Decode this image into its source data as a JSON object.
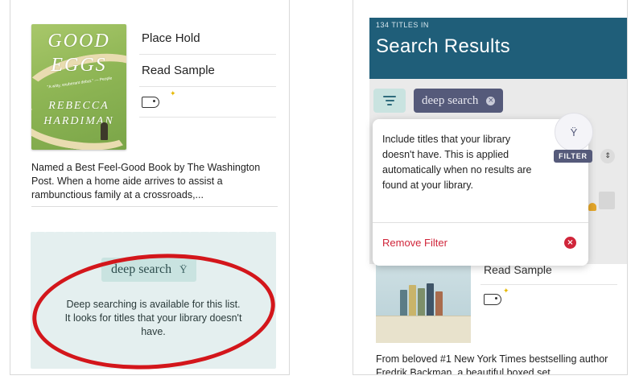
{
  "left": {
    "cover": {
      "title": "GOOD\nEGGS",
      "blurb": "\"A witty, exuberant debut.\" — People",
      "author": "REBECCA\nHARDIMAN"
    },
    "actions": [
      "Place Hold",
      "Read Sample"
    ],
    "tag_icon": "tag-icon",
    "description": "Named a Best Feel-Good Book by The Washington Post. When a home aide arrives to assist a rambunctious family at a crossroads,...",
    "deep_search": {
      "chip_label": "deep search",
      "chip_icon": "funnel-icon",
      "message": "Deep searching is available for this list. It looks for titles that your library doesn't have."
    },
    "highlight_color": "#d3161b"
  },
  "right": {
    "header": {
      "count": "134 TITLES IN",
      "title": "Search Results",
      "color": "#1f5e79"
    },
    "filter_button_icon": "filter-lines-icon",
    "search_chip": {
      "label": "deep search",
      "clear_icon": "clear-x-icon"
    },
    "popover": {
      "text": "Include titles that your library doesn't have. This is applied automatically when no results are found at your library.",
      "remove_label": "Remove Filter",
      "remove_icon": "remove-x-icon",
      "funnel_icon": "funnel-icon",
      "badge": "FILTER"
    },
    "sort_icon": "sort-icon",
    "actions": [
      "Read Sample"
    ],
    "description": "From beloved #1 New York Times bestselling author Fredrik Backman, a beautiful boxed set"
  }
}
